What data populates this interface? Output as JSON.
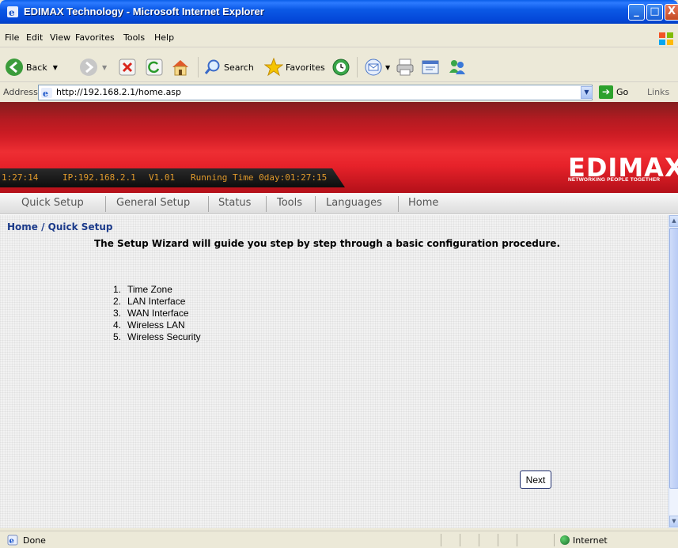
{
  "window": {
    "title": "EDIMAX Technology - Microsoft Internet Explorer",
    "controls": {
      "minimize": "_",
      "maximize": "□",
      "close": "X"
    }
  },
  "menu": {
    "items": [
      "File",
      "Edit",
      "View",
      "Favorites",
      "Tools",
      "Help"
    ]
  },
  "toolbar": {
    "back_label": "Back",
    "search_label": "Search",
    "favorites_label": "Favorites"
  },
  "address": {
    "label": "Address",
    "url": "http://192.168.2.1/home.asp",
    "go_label": "Go",
    "links_label": "Links"
  },
  "banner": {
    "clock": "1:27:14",
    "ip": "IP:192.168.2.1",
    "version": "V1.01",
    "running_time": "Running Time 0day:01:27:15",
    "logo_text": "EDIMAX",
    "tagline": "NETWORKING PEOPLE TOGETHER",
    "brand_color": "#e0252b",
    "status_text_color": "#e09a2c"
  },
  "nav": {
    "items": [
      "Quick Setup",
      "General Setup",
      "Status",
      "Tools",
      "Languages",
      "Home"
    ]
  },
  "page": {
    "breadcrumb": "Home / Quick Setup",
    "intro": "The Setup Wizard will guide you step by step through a basic configuration procedure.",
    "steps": [
      {
        "num": "1.",
        "label": "Time Zone"
      },
      {
        "num": "2.",
        "label": "LAN Interface"
      },
      {
        "num": "3.",
        "label": "WAN Interface"
      },
      {
        "num": "4.",
        "label": "Wireless LAN"
      },
      {
        "num": "5.",
        "label": "Wireless Security"
      }
    ],
    "next_label": "Next"
  },
  "statusbar": {
    "text": "Done",
    "zone": "Internet"
  }
}
